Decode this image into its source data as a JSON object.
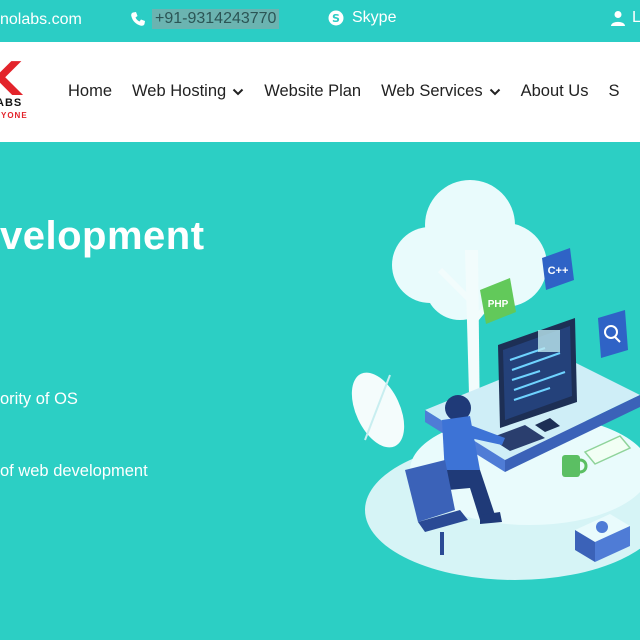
{
  "topbar": {
    "email": "nolabs.com",
    "phone": "+91-9314243770",
    "skype": "Skype",
    "login": "Lo"
  },
  "nav": {
    "logo_letter": "K",
    "logo_line1": "ABS",
    "logo_line2": "YONE",
    "items": [
      {
        "label": "Home"
      },
      {
        "label": "Web Hosting"
      },
      {
        "label": "Website Plan"
      },
      {
        "label": "Web Services"
      },
      {
        "label": "About Us"
      },
      {
        "label": "S"
      }
    ]
  },
  "hero": {
    "title": "velopment",
    "bullet1": "ority of OS",
    "bullet2": "of web development"
  },
  "illustration": {
    "badges": [
      "C++",
      "PHP"
    ]
  },
  "colors": {
    "teal": "#2ccfc4",
    "brand_red": "#e3242b"
  }
}
